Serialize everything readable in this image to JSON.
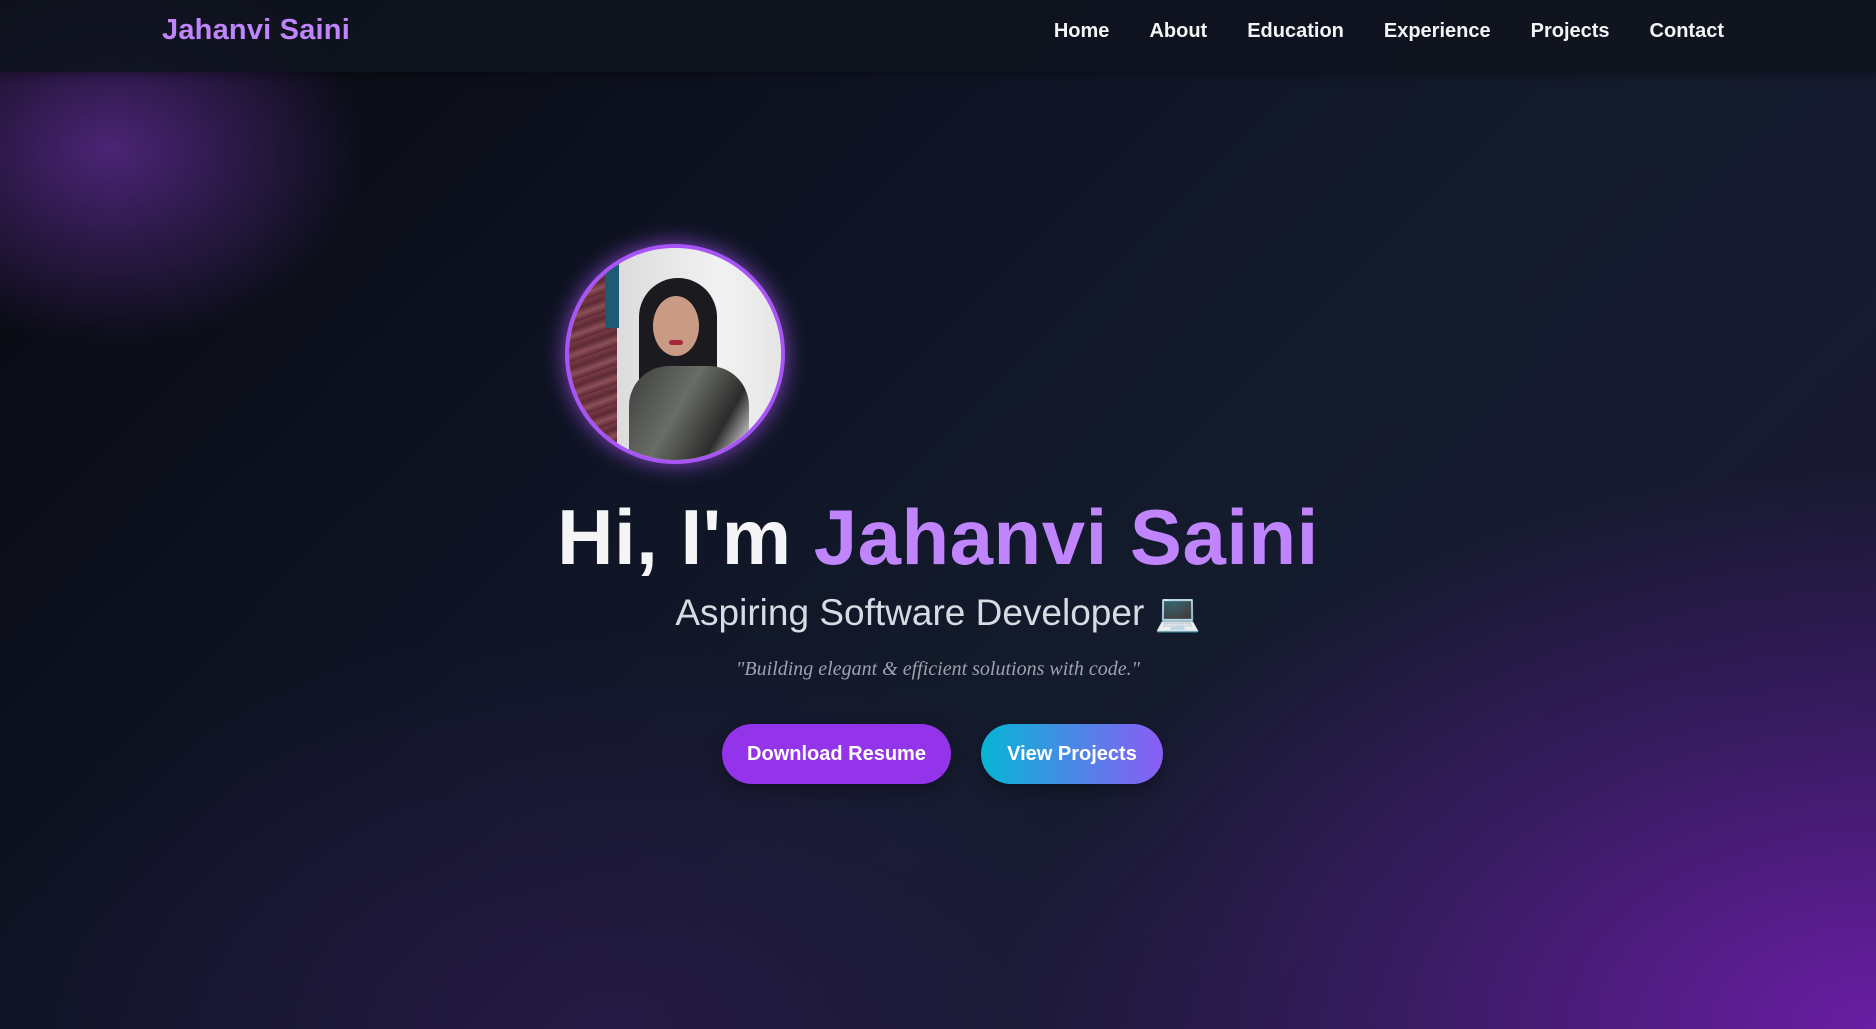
{
  "navbar": {
    "brand": "Jahanvi Saini",
    "links": [
      "Home",
      "About",
      "Education",
      "Experience",
      "Projects",
      "Contact"
    ]
  },
  "hero": {
    "greeting": "Hi, I'm ",
    "name": "Jahanvi Saini",
    "subtitle": "Aspiring Software Developer 💻",
    "quote": "\"Building elegant & efficient solutions with code.\"",
    "buttons": {
      "resume": "Download Resume",
      "projects": "View Projects"
    }
  },
  "colors": {
    "accent": "#c084fc",
    "button_primary": "#9333ea",
    "button_gradient_start": "#06b6d4",
    "button_gradient_end": "#8b5cf6",
    "avatar_border": "#a855f7"
  }
}
